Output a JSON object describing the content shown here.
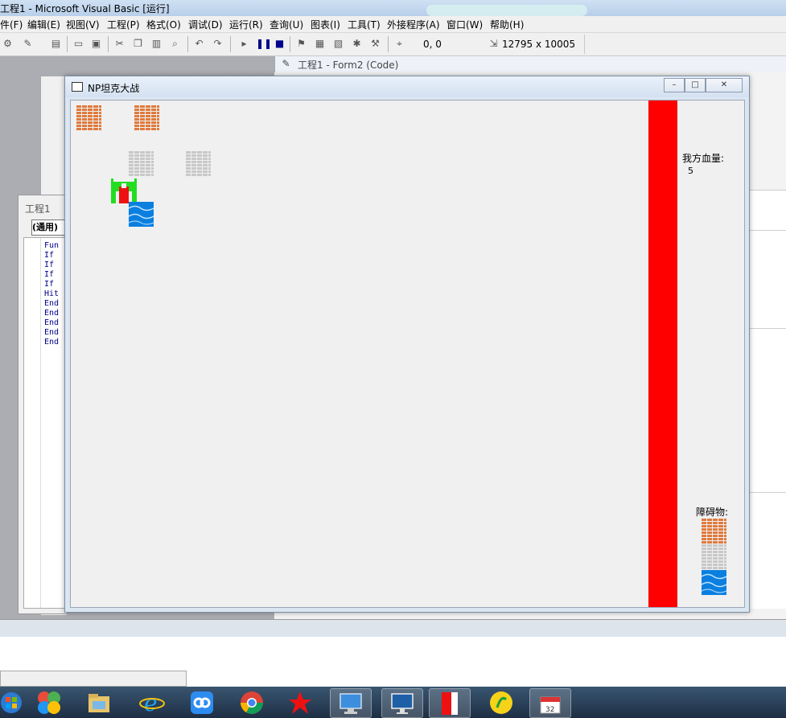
{
  "ide": {
    "title": "工程1 - Microsoft Visual Basic [运行]",
    "menus": [
      "件(F)",
      "编辑(E)",
      "视图(V)",
      "工程(P)",
      "格式(O)",
      "调试(D)",
      "运行(R)",
      "查询(U)",
      "图表(I)",
      "工具(T)",
      "外接程序(A)",
      "窗口(W)",
      "帮助(H)"
    ],
    "position_readout": "0, 0",
    "size_readout": "12795 x 10005",
    "code_window_title": "工程1 - Form2 (Code)",
    "left_window_title": "工程1",
    "left_combo": "(通用)",
    "code_lines": [
      "Fun",
      "If",
      "If",
      "If",
      "If",
      "Hit",
      "End",
      "End",
      "End",
      "End",
      "End"
    ]
  },
  "game": {
    "window_title": "NP坦克大战",
    "hp_label": "我方血量:",
    "hp_value": "5",
    "obstacle_label": "障碍物:"
  },
  "colors": {
    "brick": "#e07a3c",
    "steel": "#c8c8c8",
    "water": "#0a7fe0",
    "wall": "#ff0000",
    "tank_body": "#22dd22",
    "tank_core": "#ee1111"
  },
  "taskbar": {
    "icons": [
      "windows-start-icon",
      "color-swirl-icon",
      "file-explorer-icon",
      "internet-explorer-icon",
      "baidu-cloud-icon",
      "chrome-icon",
      "red-app-icon",
      "remote-desktop-icon",
      "monitor-app-icon",
      "red-white-app-icon",
      "music-app-icon",
      "calendar-app-icon"
    ]
  }
}
